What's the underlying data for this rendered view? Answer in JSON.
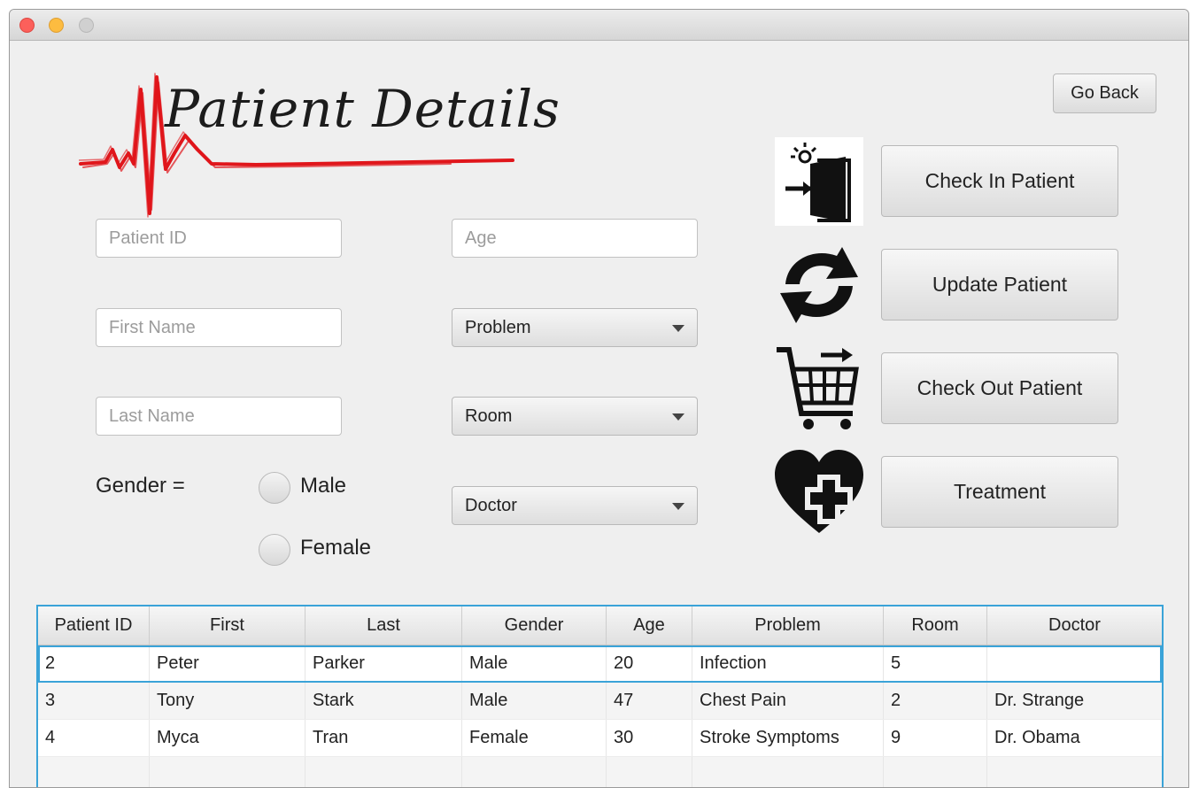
{
  "window": {
    "controls": [
      "close",
      "minimize",
      "maximize"
    ]
  },
  "header": {
    "title": "Patient Details",
    "go_back_label": "Go Back",
    "logo_color": "#e0161b"
  },
  "form": {
    "patient_id_placeholder": "Patient ID",
    "first_name_placeholder": "First Name",
    "last_name_placeholder": "Last Name",
    "age_placeholder": "Age",
    "problem_selected": "Problem",
    "room_selected": "Room",
    "doctor_selected": "Doctor",
    "gender_label": "Gender =",
    "gender_male": "Male",
    "gender_female": "Female"
  },
  "actions": [
    {
      "label": "Check In Patient",
      "icon": "door-enter-icon"
    },
    {
      "label": "Update Patient",
      "icon": "refresh-arrows-icon"
    },
    {
      "label": "Check Out Patient",
      "icon": "shopping-cart-icon"
    },
    {
      "label": "Treatment",
      "icon": "heart-plus-icon"
    }
  ],
  "table": {
    "columns": [
      "Patient ID",
      "First",
      "Last",
      "Gender",
      "Age",
      "Problem",
      "Room",
      "Doctor"
    ],
    "rows": [
      [
        "2",
        "Peter",
        "Parker",
        "Male",
        "20",
        "Infection",
        "5",
        ""
      ],
      [
        "3",
        "Tony",
        "Stark",
        "Male",
        "47",
        "Chest Pain",
        "2",
        "Dr. Strange"
      ],
      [
        "4",
        "Myca",
        "Tran",
        "Female",
        "30",
        "Stroke Symptoms",
        "9",
        "Dr. Obama"
      ]
    ],
    "selection_color": "#3aa3d8"
  }
}
